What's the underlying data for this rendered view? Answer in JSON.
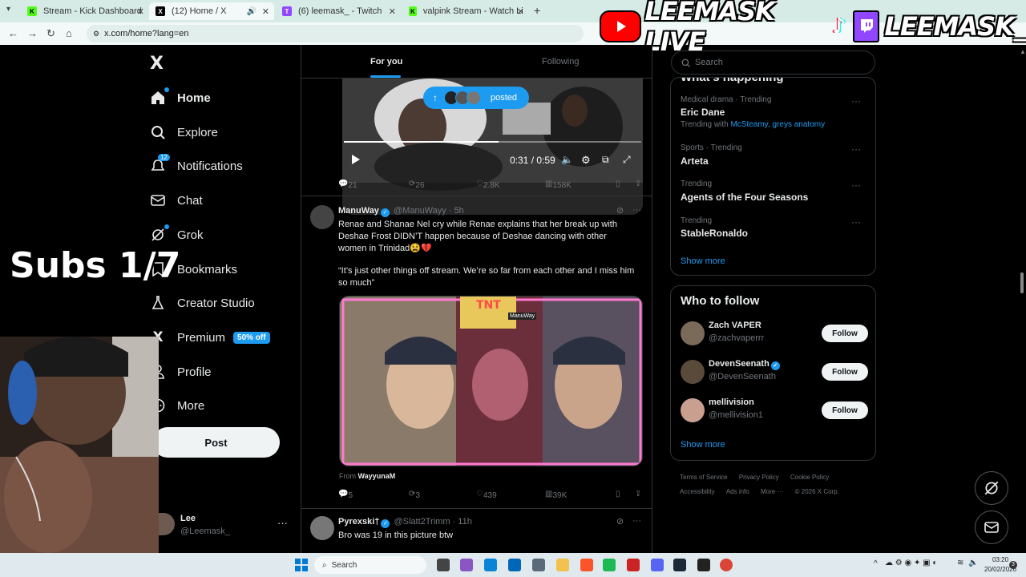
{
  "browser": {
    "tabs": [
      {
        "label": "Stream - Kick Dashboard",
        "fav": "K",
        "color": "#53fc18"
      },
      {
        "label": "(12) Home / X",
        "fav": "X",
        "color": "#000000"
      },
      {
        "label": "(6) leemask_ - Twitch",
        "fav": "T",
        "color": "#9146ff"
      },
      {
        "label": "valpink Stream - Watch Live on",
        "fav": "K",
        "color": "#53fc18"
      }
    ],
    "url": "x.com/home?lang=en",
    "new_tab": "+"
  },
  "overlay": {
    "text1": "LEEMASK LIVE",
    "text2": "LEEMASK_"
  },
  "sidebar": {
    "logo": "X",
    "items": [
      {
        "label": "Home",
        "icon": "home-icon"
      },
      {
        "label": "Explore",
        "icon": "search-icon"
      },
      {
        "label": "Notifications",
        "icon": "bell-icon",
        "count": "12"
      },
      {
        "label": "Chat",
        "icon": "mail-icon"
      },
      {
        "label": "Grok",
        "icon": "grok-icon"
      },
      {
        "label": "Bookmarks",
        "icon": "bookmark-icon"
      },
      {
        "label": "Creator Studio",
        "icon": "flask-icon"
      },
      {
        "label": "Premium",
        "icon": "x-icon",
        "badge": "50% off"
      },
      {
        "label": "Profile",
        "icon": "person-icon"
      },
      {
        "label": "More",
        "icon": "more-circle-icon"
      }
    ],
    "post_label": "Post",
    "account_name": "Lee",
    "account_handle": "@Leemask_"
  },
  "stream": {
    "subs": "Subs 1/7"
  },
  "feed": {
    "tab_foryou": "For you",
    "tab_following": "Following",
    "posted_label": "posted",
    "video_time": "0:31 / 0:59",
    "video_progress": 0.52,
    "tweet1_stats": {
      "replies": "21",
      "reposts": "26",
      "likes": "2.8K",
      "views": "158K"
    },
    "tweet2": {
      "name": "ManuWay",
      "handle": "@ManuWayy",
      "time": "· 5h",
      "text1": "Renae and Shanae Nel cry while Renae explains that her break up with Deshae Frost DIDN’T happen because of Deshae dancing with other women in Trinidad😫💔",
      "text2": "“It’s just other things off stream. We’re so far from each other and I miss him so much”",
      "from_label": "From",
      "from_user": "WayyunaM",
      "overlay_tnt": "TNT",
      "overlay_name": "ManuWay",
      "replies": "5",
      "reposts": "3",
      "likes": "439",
      "views": "39K"
    },
    "tweet3": {
      "name": "Pyrexski†",
      "handle": "@Slatt2Trimm",
      "time": "· 11h",
      "text": "Bro was 19 in this picture btw"
    }
  },
  "right": {
    "search_placeholder": "Search",
    "header_partial": "What's happening",
    "trends": [
      {
        "meta": "Medical drama · Trending",
        "name": "Eric Dane",
        "extra_label": "Trending with",
        "extra_links": "McSteamy, greys anatomy"
      },
      {
        "meta": "Sports · Trending",
        "name": "Arteta"
      },
      {
        "meta": "Trending",
        "name": "Agents of the Four Seasons"
      },
      {
        "meta": "Trending",
        "name": "StableRonaldo"
      }
    ],
    "show_more": "Show more",
    "who_title": "Who to follow",
    "who": [
      {
        "name": "Zach VAPER",
        "handle": "@zachvaperrr",
        "verified": false
      },
      {
        "name": "DevenSeenath",
        "handle": "@DevenSeenath",
        "verified": true
      },
      {
        "name": "mellivision",
        "handle": "@mellivision1",
        "verified": false
      }
    ],
    "follow_label": "Follow",
    "footer": [
      "Terms of Service",
      "Privacy Policy",
      "Cookie Policy",
      "Accessibility",
      "Ads info",
      "More ···",
      "© 2026 X Corp."
    ]
  },
  "taskbar": {
    "search": "Search",
    "time": "03:20",
    "date": "20/02/2026",
    "notif": "3"
  }
}
